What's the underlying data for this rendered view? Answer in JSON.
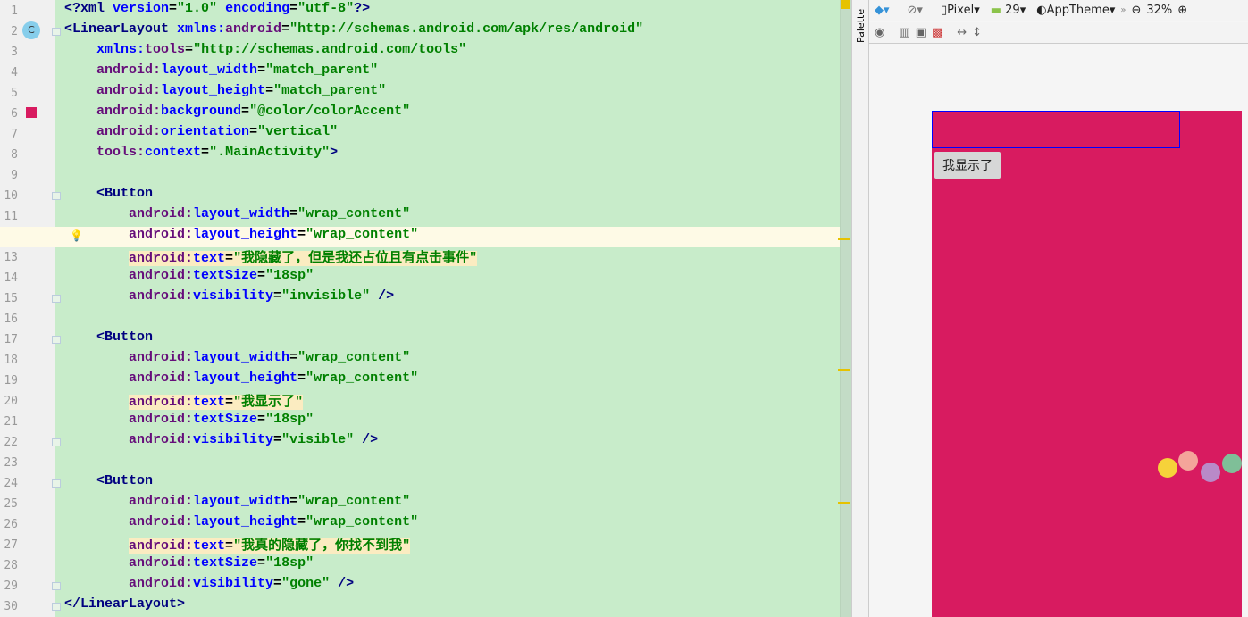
{
  "editor": {
    "lines": [
      [
        [
          "tag",
          "<?xml "
        ],
        [
          "at",
          "version"
        ],
        [
          "pl",
          "="
        ],
        [
          "val",
          "\"1.0\" "
        ],
        [
          "at",
          "encoding"
        ],
        [
          "pl",
          "="
        ],
        [
          "val",
          "\"utf-8\""
        ],
        [
          "tag",
          "?>"
        ]
      ],
      [
        [
          "tag",
          "<LinearLayout "
        ],
        [
          "at",
          "xmlns:"
        ],
        [
          "ns",
          "android"
        ],
        [
          "pl",
          "="
        ],
        [
          "val",
          "\"http://schemas.android.com/apk/res/android\""
        ]
      ],
      [
        [
          "pl",
          "    "
        ],
        [
          "at",
          "xmlns:"
        ],
        [
          "ns",
          "tools"
        ],
        [
          "pl",
          "="
        ],
        [
          "val",
          "\"http://schemas.android.com/tools\""
        ]
      ],
      [
        [
          "pl",
          "    "
        ],
        [
          "ns",
          "android:"
        ],
        [
          "at",
          "layout_width"
        ],
        [
          "pl",
          "="
        ],
        [
          "val",
          "\"match_parent\""
        ]
      ],
      [
        [
          "pl",
          "    "
        ],
        [
          "ns",
          "android:"
        ],
        [
          "at",
          "layout_height"
        ],
        [
          "pl",
          "="
        ],
        [
          "val",
          "\"match_parent\""
        ]
      ],
      [
        [
          "pl",
          "    "
        ],
        [
          "ns",
          "android:"
        ],
        [
          "at",
          "background"
        ],
        [
          "pl",
          "="
        ],
        [
          "val",
          "\"@color/colorAccent\""
        ]
      ],
      [
        [
          "pl",
          "    "
        ],
        [
          "ns",
          "android:"
        ],
        [
          "at",
          "orientation"
        ],
        [
          "pl",
          "="
        ],
        [
          "val",
          "\"vertical\""
        ]
      ],
      [
        [
          "pl",
          "    "
        ],
        [
          "ns",
          "tools:"
        ],
        [
          "at",
          "context"
        ],
        [
          "pl",
          "="
        ],
        [
          "val",
          "\".MainActivity\""
        ],
        [
          "tag",
          ">"
        ]
      ],
      [],
      [
        [
          "pl",
          "    "
        ],
        [
          "tag",
          "<Button"
        ]
      ],
      [
        [
          "pl",
          "        "
        ],
        [
          "ns",
          "android:"
        ],
        [
          "at",
          "layout_width"
        ],
        [
          "pl",
          "="
        ],
        [
          "val",
          "\"wrap_content\""
        ]
      ],
      [
        [
          "pl",
          "        "
        ],
        [
          "ns",
          "android:"
        ],
        [
          "at",
          "layout_height"
        ],
        [
          "pl",
          "="
        ],
        [
          "val",
          "\"wrap_content\""
        ]
      ],
      [
        [
          "pl",
          "        "
        ],
        [
          "ns",
          "android:"
        ],
        [
          "at",
          "text"
        ],
        [
          "pl",
          "="
        ],
        [
          "val",
          "\"我隐藏了，但是我还占位且有点击事件\""
        ]
      ],
      [
        [
          "pl",
          "        "
        ],
        [
          "ns",
          "android:"
        ],
        [
          "at",
          "textSize"
        ],
        [
          "pl",
          "="
        ],
        [
          "val",
          "\"18sp\""
        ]
      ],
      [
        [
          "pl",
          "        "
        ],
        [
          "ns",
          "android:"
        ],
        [
          "at",
          "visibility"
        ],
        [
          "pl",
          "="
        ],
        [
          "val",
          "\"invisible\" "
        ],
        [
          "tag",
          "/>"
        ]
      ],
      [],
      [
        [
          "pl",
          "    "
        ],
        [
          "tag",
          "<Button"
        ]
      ],
      [
        [
          "pl",
          "        "
        ],
        [
          "ns",
          "android:"
        ],
        [
          "at",
          "layout_width"
        ],
        [
          "pl",
          "="
        ],
        [
          "val",
          "\"wrap_content\""
        ]
      ],
      [
        [
          "pl",
          "        "
        ],
        [
          "ns",
          "android:"
        ],
        [
          "at",
          "layout_height"
        ],
        [
          "pl",
          "="
        ],
        [
          "val",
          "\"wrap_content\""
        ]
      ],
      [
        [
          "pl",
          "        "
        ],
        [
          "ns",
          "android:"
        ],
        [
          "at",
          "text"
        ],
        [
          "pl",
          "="
        ],
        [
          "val",
          "\"我显示了\""
        ]
      ],
      [
        [
          "pl",
          "        "
        ],
        [
          "ns",
          "android:"
        ],
        [
          "at",
          "textSize"
        ],
        [
          "pl",
          "="
        ],
        [
          "val",
          "\"18sp\""
        ]
      ],
      [
        [
          "pl",
          "        "
        ],
        [
          "ns",
          "android:"
        ],
        [
          "at",
          "visibility"
        ],
        [
          "pl",
          "="
        ],
        [
          "val",
          "\"visible\" "
        ],
        [
          "tag",
          "/>"
        ]
      ],
      [],
      [
        [
          "pl",
          "    "
        ],
        [
          "tag",
          "<Button"
        ]
      ],
      [
        [
          "pl",
          "        "
        ],
        [
          "ns",
          "android:"
        ],
        [
          "at",
          "layout_width"
        ],
        [
          "pl",
          "="
        ],
        [
          "val",
          "\"wrap_content\""
        ]
      ],
      [
        [
          "pl",
          "        "
        ],
        [
          "ns",
          "android:"
        ],
        [
          "at",
          "layout_height"
        ],
        [
          "pl",
          "="
        ],
        [
          "val",
          "\"wrap_content\""
        ]
      ],
      [
        [
          "pl",
          "        "
        ],
        [
          "ns",
          "android:"
        ],
        [
          "at",
          "text"
        ],
        [
          "pl",
          "="
        ],
        [
          "val",
          "\"我真的隐藏了，你找不到我\""
        ]
      ],
      [
        [
          "pl",
          "        "
        ],
        [
          "ns",
          "android:"
        ],
        [
          "at",
          "textSize"
        ],
        [
          "pl",
          "="
        ],
        [
          "val",
          "\"18sp\""
        ]
      ],
      [
        [
          "pl",
          "        "
        ],
        [
          "ns",
          "android:"
        ],
        [
          "at",
          "visibility"
        ],
        [
          "pl",
          "="
        ],
        [
          "val",
          "\"gone\" "
        ],
        [
          "tag",
          "/>"
        ]
      ],
      [
        [
          "tag",
          "</LinearLayout>"
        ]
      ]
    ],
    "current_line": 12,
    "highlighted_lines": [
      13,
      20,
      27
    ],
    "class_badge": "C",
    "color_swatch": "#d81b60"
  },
  "palette_label": "Palette",
  "toolbar": {
    "device": "Pixel",
    "api": "29",
    "theme": "AppTheme",
    "zoom": "32%"
  },
  "preview": {
    "button_text": "我显示了",
    "background": "#d81b60"
  }
}
